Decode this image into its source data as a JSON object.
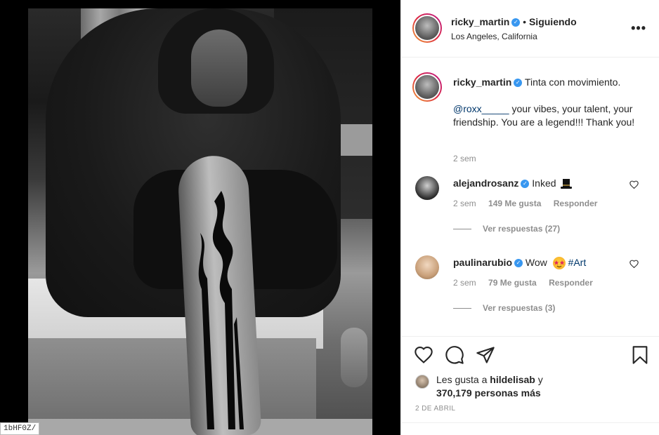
{
  "url_tooltip": "1bHF0Z/",
  "post": {
    "username": "ricky_martin",
    "follow_status": "Siguiendo",
    "separator": "•",
    "location": "Los Angeles, California",
    "more_icon": "more-horizontal-icon"
  },
  "caption": {
    "username": "ricky_martin",
    "text_line1": "Tinta con movimiento.",
    "mention": "@roxx_____",
    "text_line2": " your vibes, your talent, your friendship. You are a legend!!! Thank you!",
    "time": "2 sem"
  },
  "comments": [
    {
      "username": "alejandrosanz",
      "text": "Inked",
      "emoji": "top-hat",
      "time": "2 sem",
      "likes": "149 Me gusta",
      "reply_label": "Responder",
      "view_replies": "Ver respuestas (27)"
    },
    {
      "username": "paulinarubio",
      "text": "Wow",
      "emoji": "star-struck",
      "hashtag": "#Art",
      "time": "2 sem",
      "likes": "79 Me gusta",
      "reply_label": "Responder",
      "view_replies": "Ver respuestas (3)"
    }
  ],
  "actions": {
    "like_icon": "heart-icon",
    "comment_icon": "comment-icon",
    "share_icon": "paper-plane-icon",
    "save_icon": "bookmark-icon"
  },
  "likes": {
    "prefix": "Les gusta a ",
    "user": "hildelisab",
    "suffix_y": " y",
    "others": "370,179 personas más"
  },
  "date": "2 DE ABRIL",
  "colors": {
    "verified": "#3897f0",
    "link": "#00376b",
    "muted": "#8e8e8e",
    "text": "#262626"
  }
}
